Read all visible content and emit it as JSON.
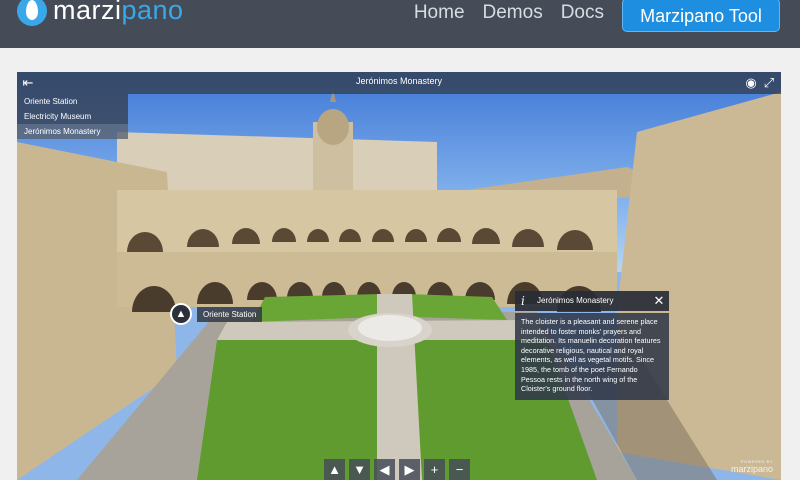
{
  "topbar": {
    "logo_prefix": "marzi",
    "logo_suffix": "pano",
    "nav": [
      {
        "label": "Home"
      },
      {
        "label": "Demos"
      },
      {
        "label": "Docs"
      }
    ],
    "cta_label": "Marzipano Tool"
  },
  "viewer": {
    "title": "Jerónimos Monastery",
    "scenes": [
      {
        "label": "Oriente Station",
        "active": false
      },
      {
        "label": "Electricity Museum",
        "active": false
      },
      {
        "label": "Jerónimos Monastery",
        "active": true
      }
    ],
    "hotspot_label": "Oriente Station",
    "info": {
      "title": "Jerónimos Monastery",
      "icon": "i",
      "text": "The cloister is a pleasant and serene place intended to foster monks' prayers and meditation. Its manuelin decoration features decorative religious, nautical and royal elements, as well as vegetal motifs. Since 1985, the tomb of the poet Fernando Pessoa rests in the north wing of the Cloister's ground floor."
    },
    "controls": [
      "▲",
      "▼",
      "◀",
      "▶",
      "+",
      "−"
    ],
    "powered_small": "POWERED BY",
    "powered_big": "marzipano"
  }
}
